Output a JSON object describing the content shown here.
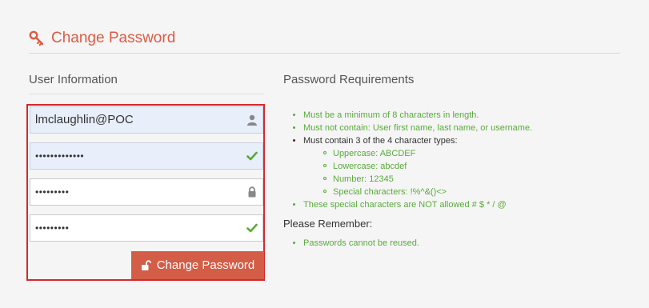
{
  "header": {
    "title": "Change Password",
    "icon": "key-icon",
    "accent": "#de5b45"
  },
  "left": {
    "title": "User Information",
    "username_value": "lmclaughlin@POC",
    "current_password_mask": "•••••••••••••",
    "new_password_mask": "•••••••••",
    "confirm_password_mask": "•••••••••",
    "submit_label": "Change Password",
    "submit_color": "#d35d47",
    "highlight_border": "#d9262b"
  },
  "right": {
    "title": "Password Requirements",
    "requirements": [
      "Must be a minimum of 8 characters in length.",
      "Must not contain: User first name, last name, or username.",
      "Must contain 3 of the 4 character types:",
      "These special characters are NOT allowed # $ * / @"
    ],
    "character_types": [
      "Uppercase: ABCDEF",
      "Lowercase: abcdef",
      "Number: 12345",
      "Special characters: !%^&()<>"
    ],
    "remember_title": "Please Remember:",
    "remember_items": [
      "Passwords cannot be reused."
    ],
    "ok_color": "#5aaa3c"
  }
}
